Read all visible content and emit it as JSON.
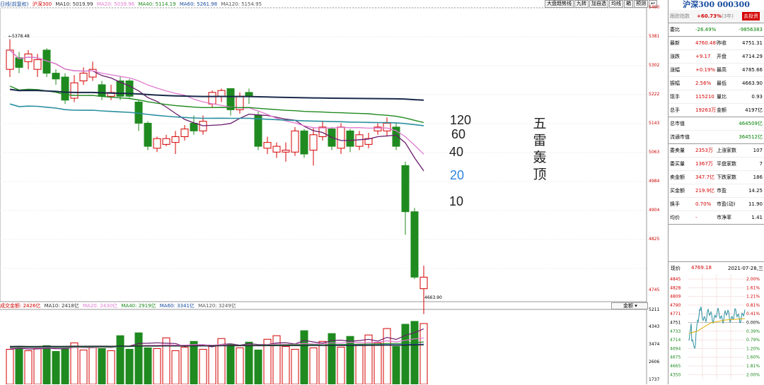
{
  "legend": {
    "mode": "日线(前复权)",
    "name": "沪深300",
    "ma10": "MA10: 5019.99",
    "ma20": "MA20: 5039.96",
    "ma40": "MA40: 5114.19",
    "ma60": "MA60: 5261.98",
    "ma120": "MA120: 5154.95"
  },
  "vol_legend": {
    "vol": "成交金额: 2426亿",
    "ma10": "MA10: 2418亿",
    "ma20": "MA20: 2430亿",
    "ma40": "MA40: 2919亿",
    "ma60": "MA60: 3341亿",
    "ma120": "MA120: 3249亿"
  },
  "toolbar": [
    "大盘趋势线",
    "九转",
    "加自选",
    "均线",
    "箱",
    "预测"
  ],
  "price_axis": [
    "5460",
    "5381",
    "5302",
    "5222",
    "5143",
    "5063",
    "4984",
    "4904",
    "4825",
    "4745"
  ],
  "vol_axis": [
    "5211",
    "4343",
    "3474",
    "2606",
    "1737"
  ],
  "annotations": {
    "high": "5378.48",
    "low": "4663.90",
    "vol_btn": "金额"
  },
  "ma_tags": {
    "ma120": "120",
    "ma60": "60",
    "ma40": "40",
    "ma20": "20",
    "ma10": "10"
  },
  "big_text": [
    "五",
    "雷",
    "轰",
    "顶"
  ],
  "colors": {
    "up": "#d40000",
    "down": "#1f8a1f",
    "ma10": "#303030",
    "ma20": "#2e86de",
    "ma40": "#1f8a1f",
    "ma60": "#1a1a1a",
    "ma120": "#222222"
  },
  "panel": {
    "title": "沪深300 000300",
    "track_label": "跟踪指数",
    "track_value": "+60.73%",
    "track_period": "(3年)",
    "track_btn": "去投资",
    "rows": [
      {
        "l": "委比",
        "v1": "-26.49%",
        "v2": "-9856383"
      },
      {
        "l": "最新",
        "v1": "4760.48",
        "m": "昨收",
        "v2": "4751.31"
      },
      {
        "l": "涨跌",
        "v1": "+9.17",
        "m": "开盘",
        "v2": "4714.29"
      },
      {
        "l": "涨幅",
        "v1": "+0.19%",
        "m": "最高",
        "v2": "4785.66"
      },
      {
        "l": "振幅",
        "v1": "2.56%",
        "m": "最低",
        "v2": "4663.90"
      },
      {
        "l": "现手",
        "v1": "115210",
        "m": "量比",
        "v2": "0.93"
      },
      {
        "l": "总手",
        "v1": "19263万",
        "m": "金额",
        "v2": "4197亿"
      },
      {
        "l": "总市值",
        "v1": "",
        "m": "",
        "v2": "464509亿"
      },
      {
        "l": "流通市值",
        "v1": "",
        "m": "",
        "v2": "364512亿"
      },
      {
        "l": "委卖量",
        "v1": "2353万",
        "m": "上涨家数",
        "v2": "107"
      },
      {
        "l": "委买量",
        "v1": "1367万",
        "m": "平盘家数",
        "v2": "7"
      },
      {
        "l": "卖金额",
        "v1": "347.7亿",
        "m": "下跌家数",
        "v2": "186"
      },
      {
        "l": "买金额",
        "v1": "219.9亿",
        "m": "市盈",
        "v2": "14.25"
      },
      {
        "l": "换手",
        "v1": "0.70%",
        "m": "市盈(动)",
        "v2": "11.90"
      },
      {
        "l": "均价",
        "v1": "-",
        "m": "市净率",
        "v2": "1.41"
      }
    ],
    "mini": {
      "price_label": "现价",
      "price": "4769.18",
      "date": "2021-07-28,三",
      "left_axis": [
        "4845",
        "4828",
        "4809",
        "4790",
        "4771",
        "4751",
        "4733",
        "4714",
        "4694",
        "4675",
        "4665",
        "4350"
      ],
      "right_axis": [
        "2.00%",
        "1.61%",
        "1.21%",
        "0.81%",
        "0.41%",
        "0.00%",
        "0.39%",
        "0.79%",
        "1.20%",
        "1.60%",
        "1.81%",
        "2.00%"
      ]
    }
  },
  "chart_data": {
    "type": "candlestick",
    "ylim": [
      4700,
      5460
    ],
    "candles": [
      {
        "o": 5300,
        "c": 5350,
        "h": 5378,
        "l": 5280
      },
      {
        "o": 5330,
        "c": 5305,
        "h": 5345,
        "l": 5290
      },
      {
        "o": 5320,
        "c": 5340,
        "h": 5350,
        "l": 5300
      },
      {
        "o": 5300,
        "c": 5325,
        "h": 5340,
        "l": 5280
      },
      {
        "o": 5350,
        "c": 5290,
        "h": 5355,
        "l": 5280
      },
      {
        "o": 5290,
        "c": 5275,
        "h": 5300,
        "l": 5260
      },
      {
        "o": 5280,
        "c": 5220,
        "h": 5290,
        "l": 5210
      },
      {
        "o": 5225,
        "c": 5265,
        "h": 5285,
        "l": 5215
      },
      {
        "o": 5270,
        "c": 5290,
        "h": 5305,
        "l": 5260
      },
      {
        "o": 5280,
        "c": 5300,
        "h": 5320,
        "l": 5270
      },
      {
        "o": 5260,
        "c": 5230,
        "h": 5270,
        "l": 5220
      },
      {
        "o": 5230,
        "c": 5240,
        "h": 5260,
        "l": 5220
      },
      {
        "o": 5270,
        "c": 5230,
        "h": 5280,
        "l": 5220
      },
      {
        "o": 5270,
        "c": 5230,
        "h": 5275,
        "l": 5225
      },
      {
        "o": 5215,
        "c": 5160,
        "h": 5220,
        "l": 5140
      },
      {
        "o": 5160,
        "c": 5100,
        "h": 5165,
        "l": 5090
      },
      {
        "o": 5095,
        "c": 5120,
        "h": 5125,
        "l": 5085
      },
      {
        "o": 5105,
        "c": 5120,
        "h": 5130,
        "l": 5100
      },
      {
        "o": 5110,
        "c": 5125,
        "h": 5140,
        "l": 5080
      },
      {
        "o": 5125,
        "c": 5145,
        "h": 5155,
        "l": 5115
      },
      {
        "o": 5160,
        "c": 5140,
        "h": 5180,
        "l": 5130
      },
      {
        "o": 5140,
        "c": 5165,
        "h": 5180,
        "l": 5130
      },
      {
        "o": 5210,
        "c": 5240,
        "h": 5245,
        "l": 5200
      },
      {
        "o": 5230,
        "c": 5245,
        "h": 5250,
        "l": 5215
      },
      {
        "o": 5250,
        "c": 5195,
        "h": 5250,
        "l": 5180
      },
      {
        "o": 5195,
        "c": 5230,
        "h": 5240,
        "l": 5185
      },
      {
        "o": 5240,
        "c": 5230,
        "h": 5250,
        "l": 5210
      },
      {
        "o": 5180,
        "c": 5100,
        "h": 5190,
        "l": 5090
      },
      {
        "o": 5095,
        "c": 5110,
        "h": 5125,
        "l": 5080
      },
      {
        "o": 5085,
        "c": 5100,
        "h": 5110,
        "l": 5070
      },
      {
        "o": 5085,
        "c": 5090,
        "h": 5110,
        "l": 5060
      },
      {
        "o": 5085,
        "c": 5140,
        "h": 5150,
        "l": 5075
      },
      {
        "o": 5140,
        "c": 5080,
        "h": 5145,
        "l": 5070
      },
      {
        "o": 5090,
        "c": 5130,
        "h": 5150,
        "l": 5050
      },
      {
        "o": 5125,
        "c": 5150,
        "h": 5165,
        "l": 5115
      },
      {
        "o": 5145,
        "c": 5100,
        "h": 5150,
        "l": 5090
      },
      {
        "o": 5095,
        "c": 5150,
        "h": 5160,
        "l": 5080
      },
      {
        "o": 5140,
        "c": 5100,
        "h": 5145,
        "l": 5085
      },
      {
        "o": 5100,
        "c": 5130,
        "h": 5140,
        "l": 5090
      },
      {
        "o": 5105,
        "c": 5120,
        "h": 5135,
        "l": 5095
      },
      {
        "o": 5140,
        "c": 5150,
        "h": 5160,
        "l": 5130
      },
      {
        "o": 5140,
        "c": 5160,
        "h": 5175,
        "l": 5125
      },
      {
        "o": 5150,
        "c": 5100,
        "h": 5160,
        "l": 5090
      },
      {
        "o": 5050,
        "c": 4930,
        "h": 5060,
        "l": 4870
      },
      {
        "o": 4930,
        "c": 4760,
        "h": 4940,
        "l": 4755
      },
      {
        "o": 4730,
        "c": 4760,
        "h": 4790,
        "l": 4664
      }
    ],
    "volume": [
      2450,
      2600,
      2350,
      2500,
      2700,
      2300,
      2550,
      2900,
      2400,
      2650,
      2500,
      2350,
      3400,
      2450,
      3600,
      2550,
      2500,
      3250,
      2350,
      2600,
      3000,
      2450,
      2700,
      3200,
      2800,
      2550,
      2950,
      2400,
      3150,
      3400,
      2650,
      2450,
      3750,
      2550,
      3000,
      3550,
      2600,
      3350,
      2800,
      3450,
      2900,
      3900,
      2650,
      4200,
      4400,
      4250
    ]
  }
}
